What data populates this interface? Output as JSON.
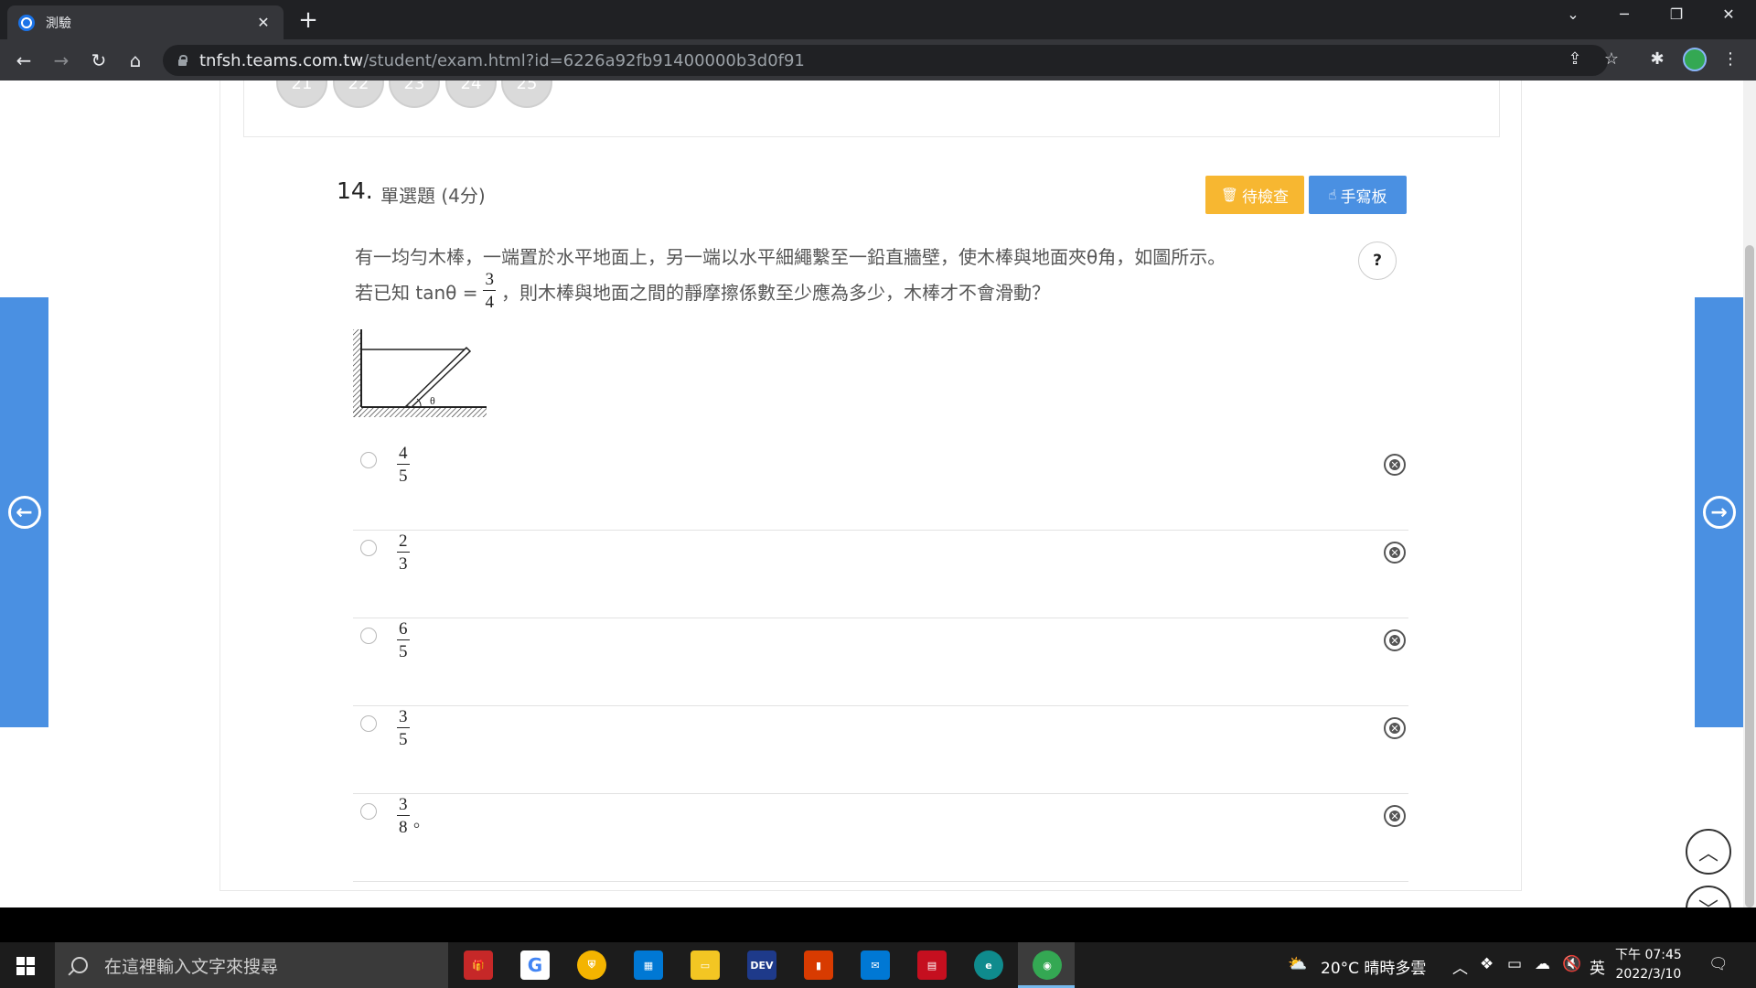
{
  "browser": {
    "tab_title": "測驗",
    "tab_close": "✕",
    "new_tab": "+",
    "url_host": "tnfsh.teams.com.tw",
    "url_path": "/student/exam.html?id=6226a92fb91400000b3d0f91"
  },
  "question_nav": [
    "21",
    "22",
    "23",
    "24",
    "25"
  ],
  "question": {
    "number": "14.",
    "type": "單選題 (4分)",
    "review_button": "待檢查",
    "handwriting_button": "手寫板",
    "help": "?",
    "stem_line1": "有一均勻木棒，一端置於水平地面上，另一端以水平細繩繫至一鉛直牆壁，使木棒與地面夾θ角，如圖所示。",
    "stem_line2_prefix": "若已知 tanθ =",
    "stem_fraction": {
      "num": "3",
      "den": "4"
    },
    "stem_line2_suffix": "，則木棒與地面之間的靜摩擦係數至少應為多少，木棒才不會滑動？",
    "figure_label": "θ",
    "options": [
      {
        "num": "4",
        "den": "5",
        "suffix": ""
      },
      {
        "num": "2",
        "den": "3",
        "suffix": ""
      },
      {
        "num": "6",
        "den": "5",
        "suffix": ""
      },
      {
        "num": "3",
        "den": "5",
        "suffix": ""
      },
      {
        "num": "3",
        "den": "8",
        "suffix": "。"
      }
    ]
  },
  "taskbar": {
    "search_placeholder": "在這裡輸入文字來搜尋",
    "weather": "20°C  晴時多雲",
    "ime": "英",
    "time": "下午 07:45",
    "date": "2022/3/10"
  },
  "colors": {
    "accent_blue": "#4a90e2",
    "review_orange": "#f7b731"
  }
}
